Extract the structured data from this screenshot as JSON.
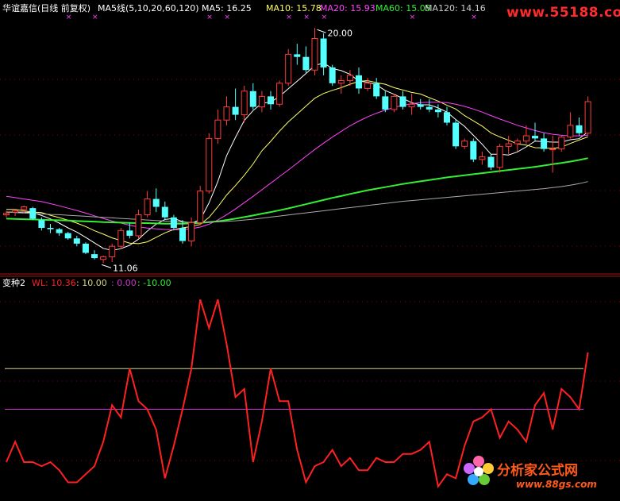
{
  "header": {
    "stock_name": "华谊嘉信(日线 前复权)",
    "ma_title": "MA5线(5,10,20,60,120)",
    "ma5": "MA5: 16.25",
    "ma10": "MA10: 15.78",
    "ma20": "MA20: 15.93",
    "ma60": "MA60: 15.05",
    "ma120": "MA120: 14.16"
  },
  "indicator_header": {
    "name": "变种2",
    "wl": "WL: 10.36",
    "v1": ": 10.00",
    "v2": ": 0.00",
    "v3": ": -10.00"
  },
  "watermarks": {
    "top": "www.55188.com",
    "logo_text": "分析家公式网",
    "logo_url": "www.88gs.com"
  },
  "colors": {
    "up": "#ff3b3b",
    "down": "#54ffff",
    "ma5": "#ffffff",
    "ma10": "#ffff66",
    "ma20": "#ff44ff",
    "ma60": "#33ee33",
    "ma120": "#aaaaaa",
    "wl": "#ff2020",
    "ref_high": "#d6d684",
    "ref_mid": "#cc33cc",
    "grid": "#8b0000"
  },
  "chart_data": [
    {
      "type": "candlestick",
      "title": "华谊嘉信(日线 前复权)",
      "ohlc": [
        [
          12.9,
          13.05,
          12.8,
          12.95
        ],
        [
          13.0,
          13.1,
          12.85,
          13.05
        ],
        [
          13.1,
          13.25,
          12.95,
          13.2
        ],
        [
          13.15,
          13.2,
          12.7,
          12.75
        ],
        [
          12.7,
          12.8,
          12.3,
          12.4
        ],
        [
          12.4,
          12.55,
          12.2,
          12.35
        ],
        [
          12.35,
          12.4,
          12.1,
          12.2
        ],
        [
          12.2,
          12.25,
          11.95,
          12.0
        ],
        [
          12.0,
          12.1,
          11.7,
          11.8
        ],
        [
          11.8,
          11.85,
          11.4,
          11.45
        ],
        [
          11.4,
          11.55,
          11.2,
          11.25
        ],
        [
          11.2,
          11.35,
          11.06,
          11.3
        ],
        [
          11.3,
          11.8,
          11.1,
          11.7
        ],
        [
          11.7,
          12.4,
          11.6,
          12.3
        ],
        [
          12.3,
          12.6,
          12.0,
          12.1
        ],
        [
          12.1,
          13.1,
          12.0,
          12.9
        ],
        [
          12.9,
          13.8,
          12.8,
          13.5
        ],
        [
          13.5,
          13.9,
          13.0,
          13.2
        ],
        [
          13.2,
          13.4,
          12.7,
          12.8
        ],
        [
          12.8,
          12.9,
          12.3,
          12.4
        ],
        [
          12.4,
          12.7,
          11.8,
          11.9
        ],
        [
          11.9,
          12.8,
          11.7,
          12.6
        ],
        [
          12.6,
          14.0,
          12.5,
          13.8
        ],
        [
          13.8,
          16.0,
          13.7,
          15.8
        ],
        [
          15.8,
          16.9,
          15.6,
          16.5
        ],
        [
          16.5,
          17.4,
          16.3,
          17.0
        ],
        [
          17.0,
          17.7,
          16.5,
          16.7
        ],
        [
          16.7,
          17.8,
          16.4,
          17.6
        ],
        [
          17.6,
          17.9,
          16.9,
          17.0
        ],
        [
          17.0,
          17.6,
          16.8,
          17.4
        ],
        [
          17.4,
          17.6,
          16.9,
          17.1
        ],
        [
          17.1,
          18.0,
          17.0,
          17.9
        ],
        [
          17.9,
          19.2,
          17.8,
          19.0
        ],
        [
          19.0,
          19.4,
          18.6,
          18.9
        ],
        [
          18.9,
          19.3,
          18.3,
          18.4
        ],
        [
          18.4,
          20.0,
          18.2,
          19.6
        ],
        [
          19.6,
          19.8,
          18.2,
          18.5
        ],
        [
          18.5,
          18.6,
          17.8,
          17.9
        ],
        [
          17.9,
          18.2,
          17.5,
          18.0
        ],
        [
          18.0,
          18.4,
          17.8,
          18.2
        ],
        [
          18.2,
          18.5,
          17.5,
          17.7
        ],
        [
          17.7,
          18.1,
          17.6,
          17.9
        ],
        [
          17.9,
          18.1,
          17.3,
          17.4
        ],
        [
          17.4,
          17.6,
          16.8,
          16.9
        ],
        [
          16.9,
          17.5,
          16.8,
          17.4
        ],
        [
          17.4,
          17.6,
          16.9,
          17.0
        ],
        [
          17.0,
          17.5,
          16.7,
          17.1
        ],
        [
          17.1,
          17.3,
          16.9,
          17.0
        ],
        [
          17.0,
          17.3,
          16.8,
          16.9
        ],
        [
          16.9,
          17.1,
          16.6,
          16.8
        ],
        [
          16.8,
          17.0,
          16.3,
          16.4
        ],
        [
          16.4,
          16.5,
          15.4,
          15.5
        ],
        [
          15.5,
          15.8,
          15.4,
          15.7
        ],
        [
          15.7,
          15.8,
          14.9,
          15.0
        ],
        [
          15.0,
          15.3,
          14.8,
          15.1
        ],
        [
          15.1,
          15.2,
          14.6,
          14.7
        ],
        [
          14.7,
          15.6,
          14.5,
          15.5
        ],
        [
          15.5,
          15.9,
          15.2,
          15.6
        ],
        [
          15.6,
          15.8,
          15.3,
          15.7
        ],
        [
          15.7,
          16.3,
          15.6,
          15.9
        ],
        [
          15.9,
          16.4,
          15.7,
          15.8
        ],
        [
          15.8,
          16.0,
          15.3,
          15.4
        ],
        [
          15.4,
          15.9,
          14.5,
          15.4
        ],
        [
          15.4,
          15.9,
          15.3,
          15.85
        ],
        [
          15.85,
          16.8,
          15.8,
          16.3
        ],
        [
          16.3,
          16.6,
          15.9,
          16.0
        ],
        [
          16.0,
          17.4,
          15.9,
          17.2
        ]
      ],
      "series": [
        {
          "name": "MA5",
          "values": [
            13.0,
            13.0,
            13.0,
            12.98,
            12.87,
            12.74,
            12.58,
            12.4,
            12.24,
            12.04,
            11.83,
            11.62,
            11.54,
            11.61,
            11.74,
            11.97,
            12.28,
            12.54,
            12.72,
            12.76,
            12.64,
            12.58,
            12.71,
            13.35,
            14.16,
            15.15,
            15.84,
            16.48,
            16.86,
            17.14,
            17.18,
            17.4,
            17.69,
            17.98,
            18.27,
            18.57,
            18.67,
            18.46,
            18.38,
            18.24,
            17.98,
            17.94,
            17.84,
            17.62,
            17.48,
            17.32,
            17.16,
            17.08,
            17.08,
            16.96,
            16.8,
            16.52,
            16.26,
            15.92,
            15.58,
            15.2,
            15.2,
            15.17,
            15.29,
            15.48,
            15.7,
            15.68,
            15.66,
            15.66,
            15.75,
            15.79,
            16.05
          ]
        },
        {
          "name": "MA10",
          "values": [
            13.1,
            13.1,
            13.05,
            13.0,
            12.98,
            12.88,
            12.79,
            12.69,
            12.58,
            12.45,
            12.29,
            12.16,
            12.02,
            11.92,
            11.82,
            11.8,
            11.87,
            12.04,
            12.21,
            12.34,
            12.4,
            12.45,
            12.53,
            12.8,
            13.2,
            13.65,
            14.01,
            14.4,
            14.83,
            15.33,
            15.69,
            16.08,
            16.43,
            16.73,
            17.03,
            17.33,
            17.51,
            17.63,
            17.73,
            17.86,
            17.97,
            18.0,
            17.92,
            17.86,
            17.73,
            17.64,
            17.55,
            17.49,
            17.35,
            17.22,
            17.06,
            16.92,
            16.67,
            16.47,
            16.27,
            16.01,
            15.86,
            15.73,
            15.59,
            15.55,
            15.45,
            15.44,
            15.42,
            15.47,
            15.61,
            15.74,
            15.86
          ]
        },
        {
          "name": "MA20",
          "values": [
            13.6,
            13.55,
            13.5,
            13.45,
            13.4,
            13.32,
            13.24,
            13.15,
            13.06,
            12.96,
            12.86,
            12.76,
            12.66,
            12.58,
            12.5,
            12.44,
            12.39,
            12.36,
            12.34,
            12.33,
            12.33,
            12.37,
            12.43,
            12.54,
            12.7,
            12.9,
            13.12,
            13.36,
            13.6,
            13.85,
            14.1,
            14.35,
            14.6,
            14.86,
            15.12,
            15.38,
            15.62,
            15.85,
            16.07,
            16.28,
            16.46,
            16.62,
            16.76,
            16.88,
            16.98,
            17.06,
            17.12,
            17.16,
            17.18,
            17.18,
            17.16,
            17.1,
            17.02,
            16.92,
            16.8,
            16.67,
            16.54,
            16.42,
            16.3,
            16.2,
            16.1,
            16.02,
            15.96,
            15.92,
            15.9,
            15.9,
            15.93
          ]
        },
        {
          "name": "MA60",
          "values": [
            12.75,
            12.74,
            12.73,
            12.72,
            12.71,
            12.7,
            12.69,
            12.68,
            12.66,
            12.65,
            12.64,
            12.62,
            12.61,
            12.6,
            12.59,
            12.58,
            12.58,
            12.57,
            12.56,
            12.56,
            12.56,
            12.57,
            12.59,
            12.62,
            12.65,
            12.7,
            12.75,
            12.81,
            12.87,
            12.94,
            13.0,
            13.07,
            13.14,
            13.22,
            13.3,
            13.38,
            13.46,
            13.54,
            13.61,
            13.69,
            13.76,
            13.83,
            13.89,
            13.95,
            14.01,
            14.07,
            14.12,
            14.17,
            14.22,
            14.27,
            14.32,
            14.36,
            14.4,
            14.44,
            14.48,
            14.52,
            14.56,
            14.6,
            14.64,
            14.68,
            14.72,
            14.77,
            14.82,
            14.87,
            14.92,
            14.98,
            15.05
          ]
        },
        {
          "name": "MA120",
          "values": [
            13.0,
            12.98,
            12.96,
            12.95,
            12.93,
            12.91,
            12.9,
            12.88,
            12.86,
            12.84,
            12.82,
            12.8,
            12.78,
            12.76,
            12.74,
            12.72,
            12.7,
            12.68,
            12.66,
            12.64,
            12.62,
            12.61,
            12.61,
            12.62,
            12.63,
            12.65,
            12.67,
            12.7,
            12.73,
            12.77,
            12.81,
            12.85,
            12.89,
            12.93,
            12.97,
            13.01,
            13.05,
            13.09,
            13.13,
            13.17,
            13.21,
            13.25,
            13.29,
            13.33,
            13.37,
            13.41,
            13.44,
            13.47,
            13.5,
            13.53,
            13.56,
            13.59,
            13.62,
            13.65,
            13.68,
            13.71,
            13.74,
            13.77,
            13.8,
            13.83,
            13.86,
            13.89,
            13.93,
            13.97,
            14.02,
            14.08,
            14.16
          ]
        }
      ],
      "annotations": [
        {
          "label": "20.00",
          "value": 20.0
        },
        {
          "label": "11.06",
          "value": 11.06
        }
      ],
      "ylim": [
        10.8,
        20.4
      ]
    },
    {
      "type": "line",
      "title": "变种2",
      "series": [
        {
          "name": "WL",
          "values": [
            -13,
            -8,
            -13,
            -13,
            -14,
            -13,
            -15,
            -18,
            -18,
            -16,
            -14,
            -8,
            1,
            -2,
            10,
            2,
            0,
            -5,
            -17,
            -9,
            0,
            10,
            27,
            20,
            27,
            16,
            3,
            5,
            -13,
            -3,
            10,
            2,
            2,
            -10,
            -18,
            -14,
            -13,
            -10,
            -14,
            -12,
            -15,
            -15,
            -12,
            -13,
            -13,
            -11,
            -11,
            -10,
            -8,
            -19,
            -16,
            -17,
            -9,
            -3,
            -2,
            0,
            -7,
            -3,
            -5,
            -8,
            1,
            4,
            -5,
            5,
            3,
            0,
            14
          ]
        },
        {
          "name": "ref",
          "values": [
            10.0
          ]
        },
        {
          "name": "ref",
          "values": [
            0.0
          ]
        },
        {
          "name": "ref",
          "values": [
            -10.0
          ]
        }
      ],
      "ylim": [
        -22,
        30
      ]
    }
  ]
}
